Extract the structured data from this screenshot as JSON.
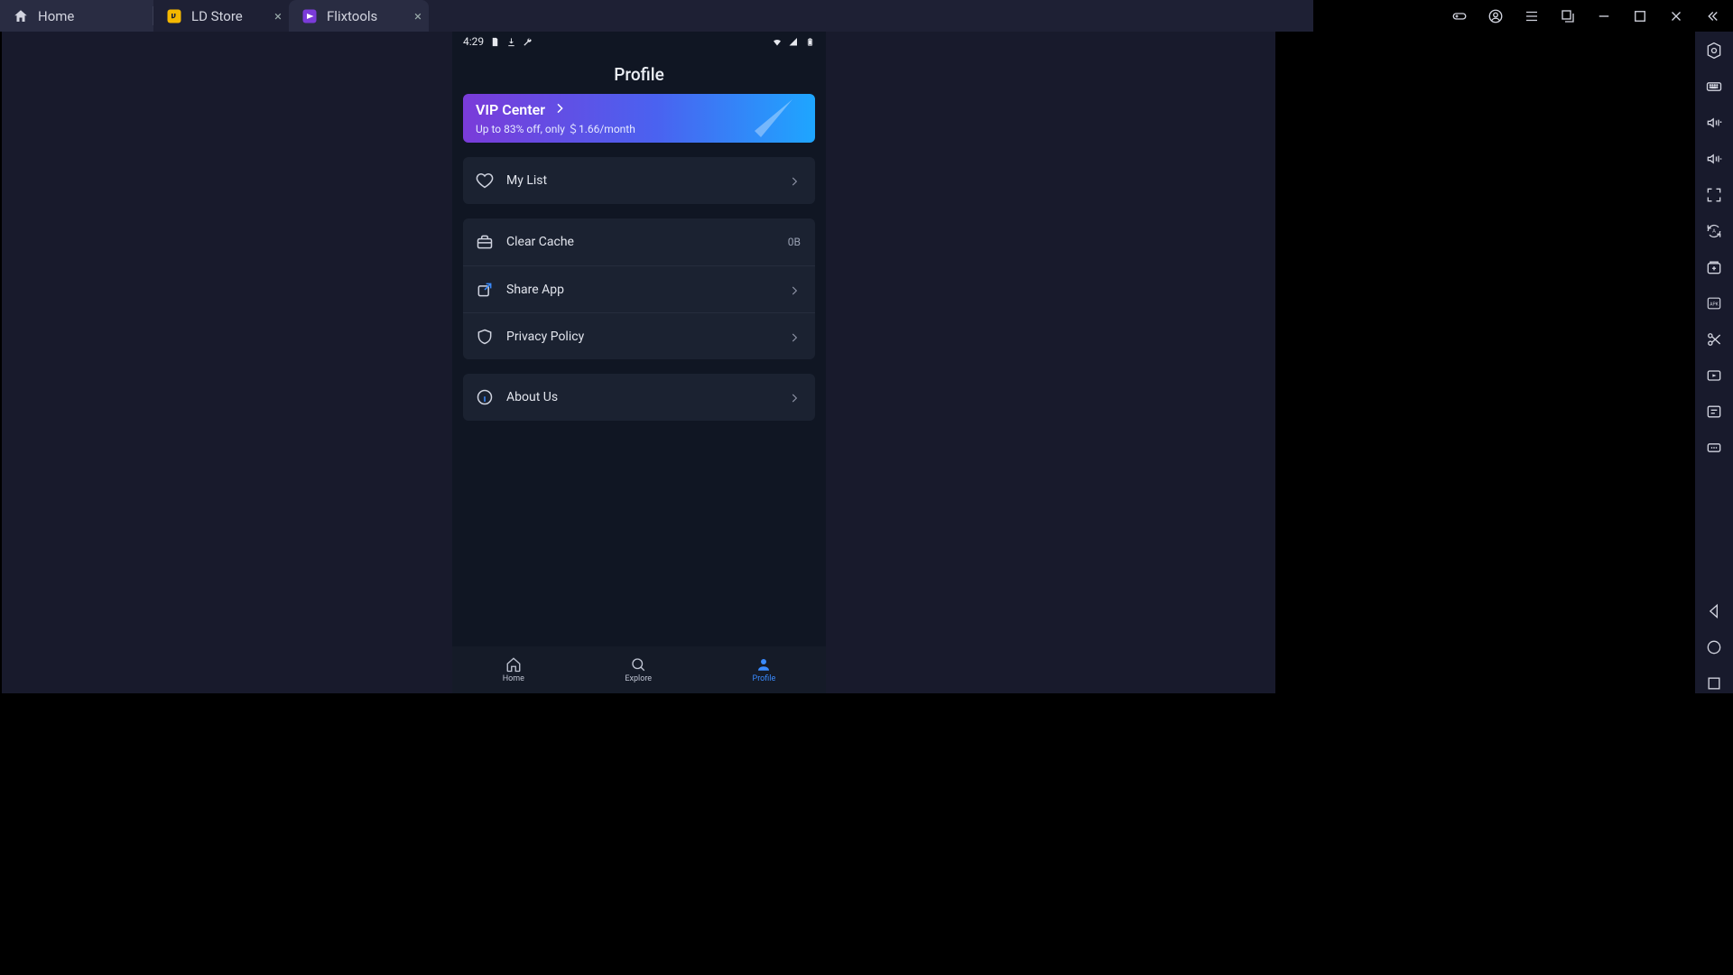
{
  "emulator": {
    "tabs": [
      {
        "label": "Home",
        "closable": false
      },
      {
        "label": "LD Store",
        "closable": true
      },
      {
        "label": "Flixtools",
        "closable": true,
        "active": true
      }
    ]
  },
  "statusbar": {
    "time": "4:29"
  },
  "page": {
    "title": "Profile"
  },
  "vip": {
    "title": "VIP Center",
    "subtitle": "Up to 83% off, only ＄1.66/month"
  },
  "sections": {
    "my_list_label": "My List",
    "clear_cache_label": "Clear Cache",
    "clear_cache_value": "0B",
    "share_app_label": "Share App",
    "privacy_policy_label": "Privacy Policy",
    "about_us_label": "About Us"
  },
  "bottom_nav": {
    "home": "Home",
    "explore": "Explore",
    "profile": "Profile"
  }
}
